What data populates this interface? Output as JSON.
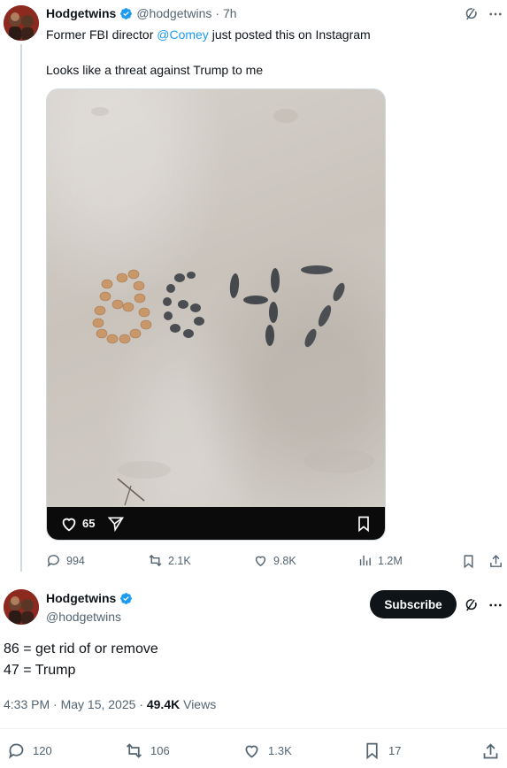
{
  "colors": {
    "accent": "#1d9bf0",
    "text": "#0f1419",
    "muted": "#536471"
  },
  "quoted_post": {
    "display_name": "Hodgetwins",
    "handle": "@hodgetwins",
    "time": "· 7h",
    "text_prefix": "Former FBI director ",
    "mention": "@Comey",
    "text_suffix": " just posted this on Instagram",
    "text_line2": "Looks like a threat against Trump to me",
    "photo": {
      "sand_text": "8647",
      "like_count": "65"
    },
    "stats": {
      "replies": "994",
      "reposts": "2.1K",
      "likes": "9.8K",
      "views": "1.2M"
    }
  },
  "main_post": {
    "display_name": "Hodgetwins",
    "handle": "@hodgetwins",
    "subscribe_label": "Subscribe",
    "line1": "86 = get rid of or remove",
    "line2": "47 = Trump",
    "timestamp": "4:33 PM · May 15, 2025 · ",
    "views_count": "49.4K",
    "views_label": " Views",
    "stats": {
      "replies": "120",
      "reposts": "106",
      "likes": "1.3K",
      "bookmarks": "17"
    }
  }
}
